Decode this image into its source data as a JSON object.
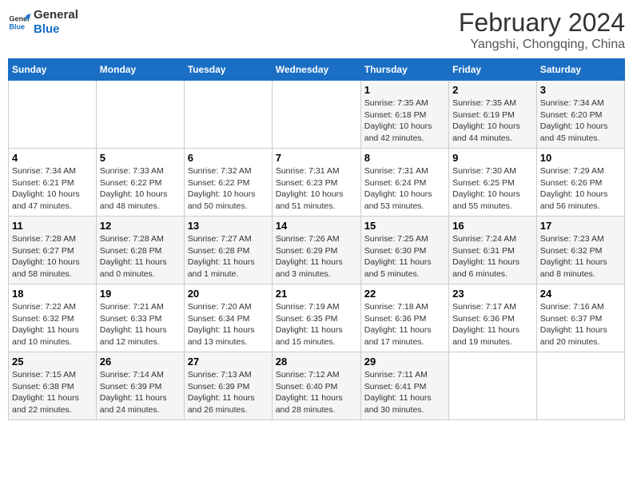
{
  "logo": {
    "line1": "General",
    "line2": "Blue"
  },
  "title": "February 2024",
  "location": "Yangshi, Chongqing, China",
  "days_of_week": [
    "Sunday",
    "Monday",
    "Tuesday",
    "Wednesday",
    "Thursday",
    "Friday",
    "Saturday"
  ],
  "weeks": [
    [
      {
        "day": "",
        "info": ""
      },
      {
        "day": "",
        "info": ""
      },
      {
        "day": "",
        "info": ""
      },
      {
        "day": "",
        "info": ""
      },
      {
        "day": "1",
        "info": "Sunrise: 7:35 AM\nSunset: 6:18 PM\nDaylight: 10 hours\nand 42 minutes."
      },
      {
        "day": "2",
        "info": "Sunrise: 7:35 AM\nSunset: 6:19 PM\nDaylight: 10 hours\nand 44 minutes."
      },
      {
        "day": "3",
        "info": "Sunrise: 7:34 AM\nSunset: 6:20 PM\nDaylight: 10 hours\nand 45 minutes."
      }
    ],
    [
      {
        "day": "4",
        "info": "Sunrise: 7:34 AM\nSunset: 6:21 PM\nDaylight: 10 hours\nand 47 minutes."
      },
      {
        "day": "5",
        "info": "Sunrise: 7:33 AM\nSunset: 6:22 PM\nDaylight: 10 hours\nand 48 minutes."
      },
      {
        "day": "6",
        "info": "Sunrise: 7:32 AM\nSunset: 6:22 PM\nDaylight: 10 hours\nand 50 minutes."
      },
      {
        "day": "7",
        "info": "Sunrise: 7:31 AM\nSunset: 6:23 PM\nDaylight: 10 hours\nand 51 minutes."
      },
      {
        "day": "8",
        "info": "Sunrise: 7:31 AM\nSunset: 6:24 PM\nDaylight: 10 hours\nand 53 minutes."
      },
      {
        "day": "9",
        "info": "Sunrise: 7:30 AM\nSunset: 6:25 PM\nDaylight: 10 hours\nand 55 minutes."
      },
      {
        "day": "10",
        "info": "Sunrise: 7:29 AM\nSunset: 6:26 PM\nDaylight: 10 hours\nand 56 minutes."
      }
    ],
    [
      {
        "day": "11",
        "info": "Sunrise: 7:28 AM\nSunset: 6:27 PM\nDaylight: 10 hours\nand 58 minutes."
      },
      {
        "day": "12",
        "info": "Sunrise: 7:28 AM\nSunset: 6:28 PM\nDaylight: 11 hours\nand 0 minutes."
      },
      {
        "day": "13",
        "info": "Sunrise: 7:27 AM\nSunset: 6:28 PM\nDaylight: 11 hours\nand 1 minute."
      },
      {
        "day": "14",
        "info": "Sunrise: 7:26 AM\nSunset: 6:29 PM\nDaylight: 11 hours\nand 3 minutes."
      },
      {
        "day": "15",
        "info": "Sunrise: 7:25 AM\nSunset: 6:30 PM\nDaylight: 11 hours\nand 5 minutes."
      },
      {
        "day": "16",
        "info": "Sunrise: 7:24 AM\nSunset: 6:31 PM\nDaylight: 11 hours\nand 6 minutes."
      },
      {
        "day": "17",
        "info": "Sunrise: 7:23 AM\nSunset: 6:32 PM\nDaylight: 11 hours\nand 8 minutes."
      }
    ],
    [
      {
        "day": "18",
        "info": "Sunrise: 7:22 AM\nSunset: 6:32 PM\nDaylight: 11 hours\nand 10 minutes."
      },
      {
        "day": "19",
        "info": "Sunrise: 7:21 AM\nSunset: 6:33 PM\nDaylight: 11 hours\nand 12 minutes."
      },
      {
        "day": "20",
        "info": "Sunrise: 7:20 AM\nSunset: 6:34 PM\nDaylight: 11 hours\nand 13 minutes."
      },
      {
        "day": "21",
        "info": "Sunrise: 7:19 AM\nSunset: 6:35 PM\nDaylight: 11 hours\nand 15 minutes."
      },
      {
        "day": "22",
        "info": "Sunrise: 7:18 AM\nSunset: 6:36 PM\nDaylight: 11 hours\nand 17 minutes."
      },
      {
        "day": "23",
        "info": "Sunrise: 7:17 AM\nSunset: 6:36 PM\nDaylight: 11 hours\nand 19 minutes."
      },
      {
        "day": "24",
        "info": "Sunrise: 7:16 AM\nSunset: 6:37 PM\nDaylight: 11 hours\nand 20 minutes."
      }
    ],
    [
      {
        "day": "25",
        "info": "Sunrise: 7:15 AM\nSunset: 6:38 PM\nDaylight: 11 hours\nand 22 minutes."
      },
      {
        "day": "26",
        "info": "Sunrise: 7:14 AM\nSunset: 6:39 PM\nDaylight: 11 hours\nand 24 minutes."
      },
      {
        "day": "27",
        "info": "Sunrise: 7:13 AM\nSunset: 6:39 PM\nDaylight: 11 hours\nand 26 minutes."
      },
      {
        "day": "28",
        "info": "Sunrise: 7:12 AM\nSunset: 6:40 PM\nDaylight: 11 hours\nand 28 minutes."
      },
      {
        "day": "29",
        "info": "Sunrise: 7:11 AM\nSunset: 6:41 PM\nDaylight: 11 hours\nand 30 minutes."
      },
      {
        "day": "",
        "info": ""
      },
      {
        "day": "",
        "info": ""
      }
    ]
  ]
}
